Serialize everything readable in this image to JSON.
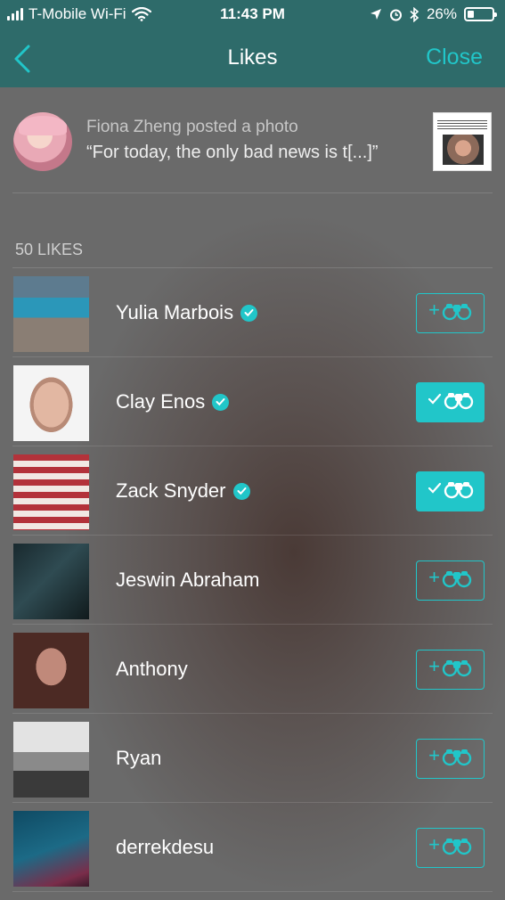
{
  "status_bar": {
    "carrier": "T-Mobile Wi-Fi",
    "time": "11:43 PM",
    "battery": "26%",
    "battery_level": 0.26,
    "icons": [
      "signal-icon",
      "wifi-icon",
      "location-icon",
      "alarm-icon",
      "bluetooth-icon",
      "battery-icon"
    ]
  },
  "nav": {
    "back_icon": "chevron-left-icon",
    "title": "Likes",
    "close_label": "Close"
  },
  "post": {
    "posted_text": "Fiona Zheng posted a photo",
    "quote": "“For today, the only bad news is t[...]”"
  },
  "likes_count": "50 LIKES",
  "likers": [
    {
      "name": "Yulia Marbois",
      "verified": true,
      "following": false
    },
    {
      "name": "Clay Enos",
      "verified": true,
      "following": true
    },
    {
      "name": "Zack Snyder",
      "verified": true,
      "following": true
    },
    {
      "name": "Jeswin Abraham",
      "verified": false,
      "following": false
    },
    {
      "name": "Anthony",
      "verified": false,
      "following": false
    },
    {
      "name": "Ryan",
      "verified": false,
      "following": false
    },
    {
      "name": "derrekdesu",
      "verified": false,
      "following": false
    }
  ],
  "colors": {
    "accent": "#21c6c9",
    "header": "#2e6b6a",
    "background": "#6a6a6a"
  }
}
